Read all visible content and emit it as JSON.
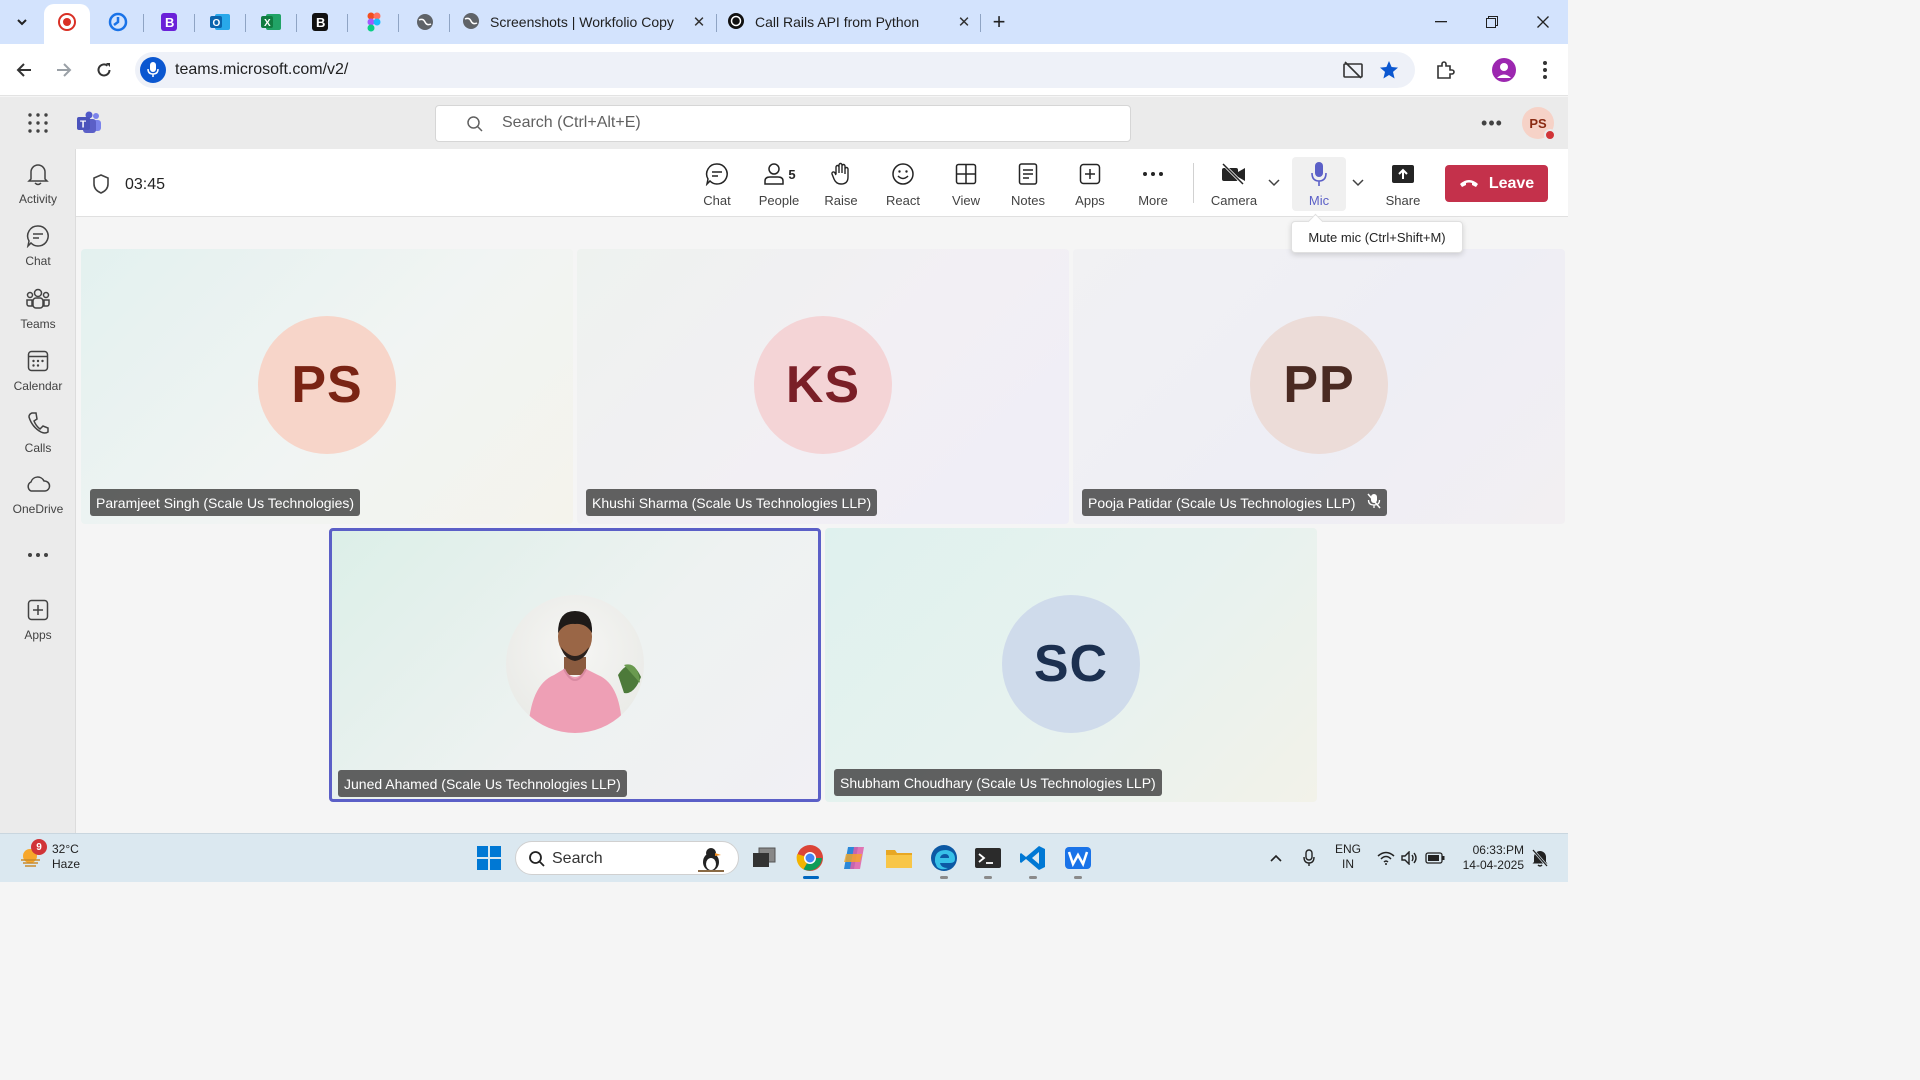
{
  "browser": {
    "tabs": [
      {
        "title": "Screenshots | Workfolio Copy"
      },
      {
        "title": "Call Rails API from Python"
      }
    ],
    "url": "teams.microsoft.com/v2/"
  },
  "teams": {
    "search_placeholder": "Search (Ctrl+Alt+E)",
    "user_initials": "PS",
    "rail": [
      {
        "label": "Activity"
      },
      {
        "label": "Chat"
      },
      {
        "label": "Teams"
      },
      {
        "label": "Calendar"
      },
      {
        "label": "Calls"
      },
      {
        "label": "OneDrive"
      },
      {
        "label": "Apps"
      }
    ]
  },
  "meeting": {
    "timer": "03:45",
    "toolbar": {
      "chat": "Chat",
      "people": "People",
      "people_count": "5",
      "raise": "Raise",
      "react": "React",
      "view": "View",
      "notes": "Notes",
      "apps": "Apps",
      "more": "More",
      "camera": "Camera",
      "mic": "Mic",
      "share": "Share",
      "leave": "Leave"
    },
    "tooltip": "Mute mic (Ctrl+Shift+M)",
    "participants": [
      {
        "initials": "PS",
        "name": "Paramjeet Singh (Scale Us Technologies)",
        "bg": "#f7d5c9",
        "fg": "#7a2414"
      },
      {
        "initials": "KS",
        "name": "Khushi Sharma (Scale Us Technologies LLP)",
        "bg": "#f4d4d6",
        "fg": "#7a1f27"
      },
      {
        "initials": "PP",
        "name": "Pooja Patidar (Scale Us Technologies LLP)",
        "bg": "#ecdcd8",
        "fg": "#4a2a22",
        "muted": true
      },
      {
        "initials": "",
        "name": "Juned Ahamed (Scale Us Technologies LLP)",
        "active_speaker": true
      },
      {
        "initials": "SC",
        "name": "Shubham Choudhary (Scale Us Technologies LLP)",
        "bg": "#cfdbeb",
        "fg": "#1c3050"
      }
    ]
  },
  "taskbar": {
    "weather_temp": "32°C",
    "weather_desc": "Haze",
    "weather_badge": "9",
    "search_label": "Search",
    "lang_1": "ENG",
    "lang_2": "IN",
    "time": "06:33:PM",
    "date": "14-04-2025"
  },
  "colors": {
    "accent": "#5b5fc7",
    "leave": "#c4314b",
    "browser_chrome": "#d3e3fd"
  }
}
